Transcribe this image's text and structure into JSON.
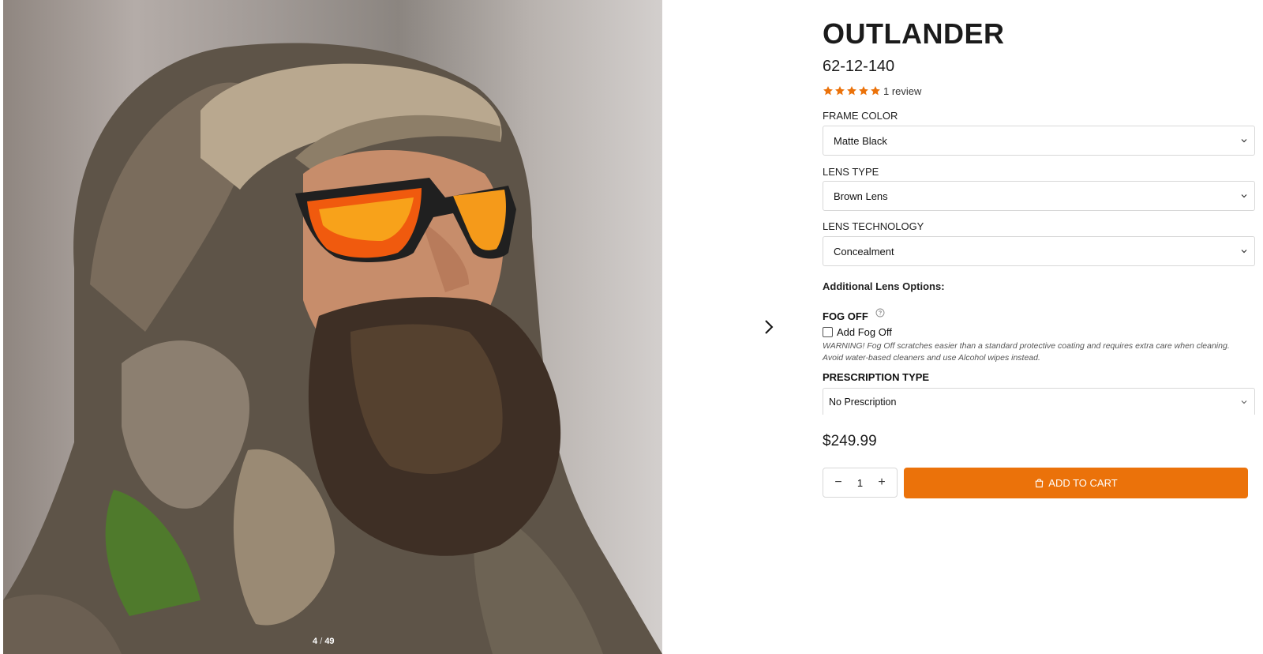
{
  "gallery": {
    "current": "4",
    "separator": "/",
    "total": "49",
    "image_alt": "Bearded man in camo hood wearing orange mirrored sunglasses"
  },
  "product": {
    "title": "OUTLANDER",
    "size": "62-12-140",
    "rating": 5,
    "review_count": "1 review",
    "price": "$249.99"
  },
  "options": {
    "frame_color": {
      "label": "FRAME COLOR",
      "value": "Matte Black"
    },
    "lens_type": {
      "label": "LENS TYPE",
      "value": "Brown Lens"
    },
    "lens_technology": {
      "label": "LENS TECHNOLOGY",
      "value": "Concealment"
    },
    "additional_heading": "Additional Lens Options:",
    "fog_off": {
      "label": "FOG OFF",
      "checkbox_label": "Add Fog Off",
      "checked": false,
      "warning": "WARNING! Fog Off scratches easier than a standard protective coating and requires extra care when cleaning. Avoid water-based cleaners and use Alcohol wipes instead."
    },
    "prescription": {
      "label": "PRESCRIPTION TYPE",
      "value": "No Prescription"
    }
  },
  "purchase": {
    "quantity": "1",
    "minus": "−",
    "plus": "+",
    "add_to_cart": "ADD TO CART"
  },
  "colors": {
    "accent": "#eb720a",
    "star": "#eb720a",
    "border": "#d8d8d8"
  },
  "icons": [
    "chevron-right-icon",
    "star-icon",
    "chevron-down-icon",
    "help-circle-icon",
    "shopping-bag-icon"
  ]
}
